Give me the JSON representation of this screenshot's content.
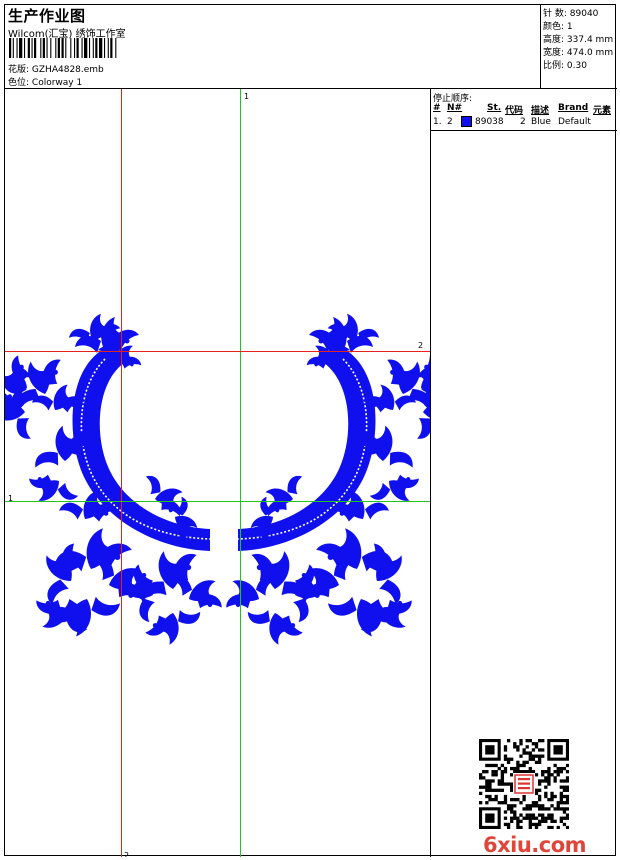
{
  "header": {
    "title": "生产作业图",
    "company": "Wilcom(汇宝) 绣饰工作室",
    "file_label": "花版:",
    "file_value": "GZHA4828.emb",
    "colorway_label": "色位:",
    "colorway_value": "Colorway 1"
  },
  "info": {
    "stitches_label": "针 数:",
    "stitches_value": "89040",
    "colors_label": "颜色:",
    "colors_value": "1",
    "height_label": "高度:",
    "height_value": "337.4 mm",
    "width_label": "宽度:",
    "width_value": "474.0 mm",
    "scale_label": "比例:",
    "scale_value": "0.30"
  },
  "guides": {
    "top_label": "1",
    "bottom_label": "2",
    "left_label": "1",
    "right_label": "2",
    "color_red": "#e82020",
    "color_green": "#22c422"
  },
  "design": {
    "color": "#1010ee"
  },
  "stop_sequence": {
    "title": "停止顺序:",
    "headers": [
      "#",
      "N#",
      "St.",
      "代码",
      "描述",
      "Brand",
      "元素"
    ],
    "rows": [
      {
        "seq": "1.",
        "needle": "2",
        "swatch": "#1010ee",
        "stitches": "89038",
        "code": "2",
        "description": "Blue",
        "brand": "Default",
        "element": ""
      }
    ]
  },
  "watermark": {
    "text": "6xiu.com",
    "color": "#e0453a"
  }
}
